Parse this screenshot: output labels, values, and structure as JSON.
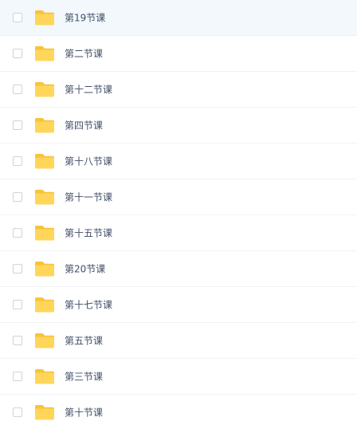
{
  "colors": {
    "folder_body": "#ffd659",
    "folder_tab": "#f8c33c",
    "row_highlight": "#f2f8fc",
    "text": "#424e67"
  },
  "folder_icon_name": "folder-icon",
  "files": [
    {
      "name": "第19节课",
      "highlighted": true
    },
    {
      "name": "第二节课",
      "highlighted": false
    },
    {
      "name": "第十二节课",
      "highlighted": false
    },
    {
      "name": "第四节课",
      "highlighted": false
    },
    {
      "name": "第十八节课",
      "highlighted": false
    },
    {
      "name": "第十一节课",
      "highlighted": false
    },
    {
      "name": "第十五节课",
      "highlighted": false
    },
    {
      "name": "第20节课",
      "highlighted": false
    },
    {
      "name": "第十七节课",
      "highlighted": false
    },
    {
      "name": "第五节课",
      "highlighted": false
    },
    {
      "name": "第三节课",
      "highlighted": false
    },
    {
      "name": "第十节课",
      "highlighted": false
    }
  ]
}
